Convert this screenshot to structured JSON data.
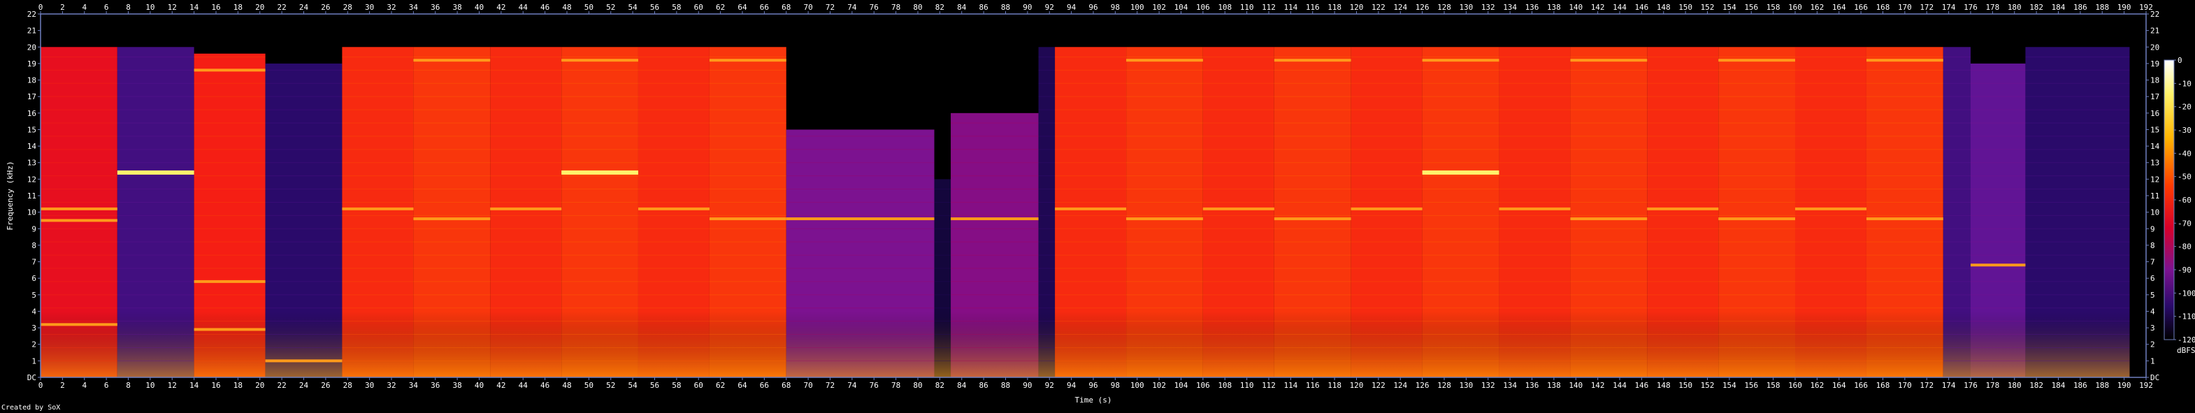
{
  "chart_data": {
    "type": "heatmap",
    "title": "",
    "xlabel": "Time (s)",
    "ylabel": "Frequency (kHz)",
    "xlim": [
      0,
      192
    ],
    "ylim": [
      0,
      22
    ],
    "x_ticks": [
      0,
      2,
      4,
      6,
      8,
      10,
      12,
      14,
      16,
      18,
      20,
      22,
      24,
      26,
      28,
      30,
      32,
      34,
      36,
      38,
      40,
      42,
      44,
      46,
      48,
      50,
      52,
      54,
      56,
      58,
      60,
      62,
      64,
      66,
      68,
      70,
      72,
      74,
      76,
      78,
      80,
      82,
      84,
      86,
      88,
      90,
      92,
      94,
      96,
      98,
      100,
      102,
      104,
      106,
      108,
      110,
      112,
      114,
      116,
      118,
      120,
      122,
      124,
      126,
      128,
      130,
      132,
      134,
      136,
      138,
      140,
      142,
      144,
      146,
      148,
      150,
      152,
      154,
      156,
      158,
      160,
      162,
      164,
      166,
      168,
      170,
      172,
      174,
      176,
      178,
      180,
      182,
      184,
      186,
      188,
      190,
      192
    ],
    "y_ticks": [
      "DC",
      "1",
      "2",
      "3",
      "4",
      "5",
      "6",
      "7",
      "8",
      "9",
      "10",
      "11",
      "12",
      "13",
      "14",
      "15",
      "16",
      "17",
      "18",
      "19",
      "20",
      "21",
      "22"
    ],
    "colorbar": {
      "label": "dBFS",
      "ticks": [
        0,
        -10,
        -20,
        -30,
        -40,
        -50,
        -60,
        -70,
        -80,
        -90,
        -100,
        -110,
        -120
      ],
      "range": [
        -120,
        0
      ]
    },
    "segments": [
      {
        "start": 0,
        "end": 7,
        "level": -55,
        "cutoff_khz": 20,
        "tones_khz": [
          3.2,
          9.5,
          10.2
        ]
      },
      {
        "start": 7,
        "end": 14,
        "level": -95,
        "cutoff_khz": 20,
        "tones_khz": [
          12.4
        ]
      },
      {
        "start": 14,
        "end": 20.5,
        "level": -50,
        "cutoff_khz": 19.6,
        "tones_khz": [
          2.9,
          5.8,
          18.6
        ]
      },
      {
        "start": 20.5,
        "end": 27.5,
        "level": -100,
        "cutoff_khz": 19,
        "tones_khz": [
          1.0
        ]
      },
      {
        "start": 27.5,
        "end": 34,
        "level": -48,
        "cutoff_khz": 20,
        "tones_khz": [
          10.2
        ]
      },
      {
        "start": 34,
        "end": 41,
        "level": -46,
        "cutoff_khz": 20,
        "tones_khz": [
          9.6,
          19.2
        ]
      },
      {
        "start": 41,
        "end": 47.5,
        "level": -48,
        "cutoff_khz": 20,
        "tones_khz": [
          10.2
        ]
      },
      {
        "start": 47.5,
        "end": 54.5,
        "level": -46,
        "cutoff_khz": 20,
        "tones_khz": [
          12.4,
          19.2
        ]
      },
      {
        "start": 54.5,
        "end": 61,
        "level": -48,
        "cutoff_khz": 20,
        "tones_khz": [
          10.2
        ]
      },
      {
        "start": 61,
        "end": 68,
        "level": -46,
        "cutoff_khz": 20,
        "tones_khz": [
          9.6,
          19.2
        ]
      },
      {
        "start": 68,
        "end": 81.5,
        "level": -80,
        "cutoff_khz": 15,
        "tones_khz": [
          9.6
        ]
      },
      {
        "start": 81.5,
        "end": 83,
        "level": -110,
        "cutoff_khz": 12,
        "tones_khz": []
      },
      {
        "start": 83,
        "end": 91,
        "level": -78,
        "cutoff_khz": 16,
        "tones_khz": [
          9.6
        ]
      },
      {
        "start": 91,
        "end": 92.5,
        "level": -105,
        "cutoff_khz": 20,
        "tones_khz": []
      },
      {
        "start": 92.5,
        "end": 99,
        "level": -48,
        "cutoff_khz": 20,
        "tones_khz": [
          10.2
        ]
      },
      {
        "start": 99,
        "end": 106,
        "level": -46,
        "cutoff_khz": 20,
        "tones_khz": [
          9.6,
          19.2
        ]
      },
      {
        "start": 106,
        "end": 112.5,
        "level": -48,
        "cutoff_khz": 20,
        "tones_khz": [
          10.2
        ]
      },
      {
        "start": 112.5,
        "end": 119.5,
        "level": -46,
        "cutoff_khz": 20,
        "tones_khz": [
          9.6,
          19.2
        ]
      },
      {
        "start": 119.5,
        "end": 126,
        "level": -48,
        "cutoff_khz": 20,
        "tones_khz": [
          10.2
        ]
      },
      {
        "start": 126,
        "end": 133,
        "level": -46,
        "cutoff_khz": 20,
        "tones_khz": [
          12.4,
          19.2
        ]
      },
      {
        "start": 133,
        "end": 139.5,
        "level": -48,
        "cutoff_khz": 20,
        "tones_khz": [
          10.2
        ]
      },
      {
        "start": 139.5,
        "end": 146.5,
        "level": -46,
        "cutoff_khz": 20,
        "tones_khz": [
          9.6,
          19.2
        ]
      },
      {
        "start": 146.5,
        "end": 153,
        "level": -48,
        "cutoff_khz": 20,
        "tones_khz": [
          10.2
        ]
      },
      {
        "start": 153,
        "end": 160,
        "level": -46,
        "cutoff_khz": 20,
        "tones_khz": [
          9.6,
          19.2
        ]
      },
      {
        "start": 160,
        "end": 166.5,
        "level": -48,
        "cutoff_khz": 20,
        "tones_khz": [
          10.2
        ]
      },
      {
        "start": 166.5,
        "end": 173.5,
        "level": -46,
        "cutoff_khz": 20,
        "tones_khz": [
          9.6,
          19.2
        ]
      },
      {
        "start": 173.5,
        "end": 176,
        "level": -95,
        "cutoff_khz": 20,
        "tones_khz": []
      },
      {
        "start": 176,
        "end": 181,
        "level": -88,
        "cutoff_khz": 19,
        "tones_khz": [
          6.8
        ]
      },
      {
        "start": 181,
        "end": 190.5,
        "level": -100,
        "cutoff_khz": 20,
        "tones_khz": []
      }
    ],
    "grid": false
  },
  "footer": {
    "text": "Created by SoX"
  },
  "colors": {
    "background": "#000000",
    "axis": "#6f7fbf",
    "text": "#ffffff"
  }
}
